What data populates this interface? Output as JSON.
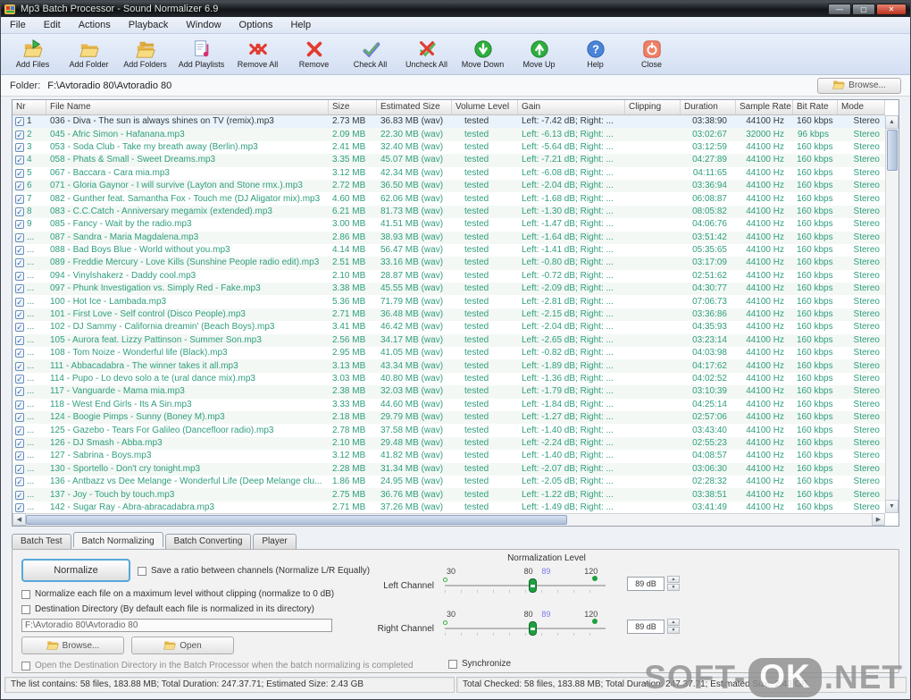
{
  "window": {
    "title": "Mp3 Batch Processor - Sound Normalizer 6.9"
  },
  "menu": {
    "items": [
      {
        "label": "File"
      },
      {
        "label": "Edit"
      },
      {
        "label": "Actions"
      },
      {
        "label": "Playback"
      },
      {
        "label": "Window"
      },
      {
        "label": "Options"
      },
      {
        "label": "Help"
      }
    ]
  },
  "toolbar": {
    "buttons": [
      {
        "label": "Add Files",
        "icon": "add-files-icon"
      },
      {
        "label": "Add Folder",
        "icon": "add-folder-icon"
      },
      {
        "label": "Add Folders",
        "icon": "add-folders-icon"
      },
      {
        "label": "Add Playlists",
        "icon": "add-playlists-icon"
      },
      {
        "label": "Remove All",
        "icon": "remove-all-icon"
      },
      {
        "label": "Remove",
        "icon": "remove-icon"
      },
      {
        "label": "Check All",
        "icon": "check-all-icon"
      },
      {
        "label": "Uncheck All",
        "icon": "uncheck-all-icon"
      },
      {
        "label": "Move Down",
        "icon": "move-down-icon"
      },
      {
        "label": "Move Up",
        "icon": "move-up-icon"
      },
      {
        "label": "Help",
        "icon": "help-icon"
      },
      {
        "label": "Close",
        "icon": "close-icon"
      }
    ]
  },
  "folder_bar": {
    "label": "Folder:",
    "path": "F:\\Avtoradio 80\\Avtoradio 80",
    "browse": "Browse..."
  },
  "table": {
    "columns": [
      {
        "label": "Nr"
      },
      {
        "label": "File Name"
      },
      {
        "label": "Size"
      },
      {
        "label": "Estimated Size"
      },
      {
        "label": "Volume Level"
      },
      {
        "label": "Gain"
      },
      {
        "label": "Clipping"
      },
      {
        "label": "Duration"
      },
      {
        "label": "Sample Rate"
      },
      {
        "label": "Bit Rate"
      },
      {
        "label": "Mode"
      }
    ],
    "rows": [
      {
        "selected": true,
        "nr": "1",
        "name": "036 - Diva - The sun is always shines on TV (remix).mp3",
        "size": "2.73 MB",
        "est": "36.83 MB (wav)",
        "vol": "tested",
        "gain": "Left: -7.42 dB; Right: ...",
        "clip": "",
        "dur": "03:38:90",
        "rate": "44100 Hz",
        "bit": "160 kbps",
        "mode": "Stereo"
      },
      {
        "nr": "2",
        "name": "045 - Afric Simon - Hafanana.mp3",
        "size": "2.09 MB",
        "est": "22.30 MB (wav)",
        "vol": "tested",
        "gain": "Left: -6.13 dB; Right: ...",
        "clip": "",
        "dur": "03:02:67",
        "rate": "32000 Hz",
        "bit": "96 kbps",
        "mode": "Stereo"
      },
      {
        "nr": "3",
        "name": "053 - Soda Club - Take my breath away (Berlin).mp3",
        "size": "2.41 MB",
        "est": "32.40 MB (wav)",
        "vol": "tested",
        "gain": "Left: -5.64 dB; Right: ...",
        "clip": "",
        "dur": "03:12:59",
        "rate": "44100 Hz",
        "bit": "160 kbps",
        "mode": "Stereo"
      },
      {
        "nr": "4",
        "name": "058 - Phats & Small - Sweet Dreams.mp3",
        "size": "3.35 MB",
        "est": "45.07 MB (wav)",
        "vol": "tested",
        "gain": "Left: -7.21 dB; Right: ...",
        "clip": "",
        "dur": "04:27:89",
        "rate": "44100 Hz",
        "bit": "160 kbps",
        "mode": "Stereo"
      },
      {
        "nr": "5",
        "name": "067 - Baccara - Cara mia.mp3",
        "size": "3.12 MB",
        "est": "42.34 MB (wav)",
        "vol": "tested",
        "gain": "Left: -6.08 dB; Right: ...",
        "clip": "",
        "dur": "04:11:65",
        "rate": "44100 Hz",
        "bit": "160 kbps",
        "mode": "Stereo"
      },
      {
        "nr": "6",
        "name": "071 - Gloria Gaynor - I will survive (Layton and Stone rmx.).mp3",
        "size": "2.72 MB",
        "est": "36.50 MB (wav)",
        "vol": "tested",
        "gain": "Left: -2.04 dB; Right: ...",
        "clip": "",
        "dur": "03:36:94",
        "rate": "44100 Hz",
        "bit": "160 kbps",
        "mode": "Stereo"
      },
      {
        "nr": "7",
        "name": "082 - Gunther feat. Samantha Fox - Touch me (DJ Aligator mix).mp3",
        "size": "4.60 MB",
        "est": "62.06 MB (wav)",
        "vol": "tested",
        "gain": "Left: -1.68 dB; Right: ...",
        "clip": "",
        "dur": "06:08:87",
        "rate": "44100 Hz",
        "bit": "160 kbps",
        "mode": "Stereo"
      },
      {
        "nr": "8",
        "name": "083 - C.C.Catch - Anniversary megamix (extended).mp3",
        "size": "6.21 MB",
        "est": "81.73 MB (wav)",
        "vol": "tested",
        "gain": "Left: -1.30 dB; Right: ...",
        "clip": "",
        "dur": "08:05:82",
        "rate": "44100 Hz",
        "bit": "160 kbps",
        "mode": "Stereo"
      },
      {
        "nr": "9",
        "name": "085 - Fancy - Wait by the radio.mp3",
        "size": "3.00 MB",
        "est": "41.51 MB (wav)",
        "vol": "tested",
        "gain": "Left: -1.47 dB; Right: ...",
        "clip": "",
        "dur": "04:06:76",
        "rate": "44100 Hz",
        "bit": "160 kbps",
        "mode": "Stereo"
      },
      {
        "nr": "...",
        "name": "087 - Sandra - Maria Magdalena.mp3",
        "size": "2.86 MB",
        "est": "38.93 MB (wav)",
        "vol": "tested",
        "gain": "Left: -1.64 dB; Right: ...",
        "clip": "",
        "dur": "03:51:42",
        "rate": "44100 Hz",
        "bit": "160 kbps",
        "mode": "Stereo"
      },
      {
        "nr": "...",
        "name": "088 - Bad Boys Blue - World without you.mp3",
        "size": "4.14 MB",
        "est": "56.47 MB (wav)",
        "vol": "tested",
        "gain": "Left: -1.41 dB; Right: ...",
        "clip": "",
        "dur": "05:35:65",
        "rate": "44100 Hz",
        "bit": "160 kbps",
        "mode": "Stereo"
      },
      {
        "nr": "...",
        "name": "089 - Freddie Mercury - Love Kills (Sunshine People radio edit).mp3",
        "size": "2.51 MB",
        "est": "33.16 MB (wav)",
        "vol": "tested",
        "gain": "Left: -0.80 dB; Right: ...",
        "clip": "",
        "dur": "03:17:09",
        "rate": "44100 Hz",
        "bit": "160 kbps",
        "mode": "Stereo"
      },
      {
        "nr": "...",
        "name": "094 - Vinylshakerz - Daddy cool.mp3",
        "size": "2.10 MB",
        "est": "28.87 MB (wav)",
        "vol": "tested",
        "gain": "Left: -0.72 dB; Right: ...",
        "clip": "",
        "dur": "02:51:62",
        "rate": "44100 Hz",
        "bit": "160 kbps",
        "mode": "Stereo"
      },
      {
        "nr": "...",
        "name": "097 - Phunk Investigation vs. Simply Red - Fake.mp3",
        "size": "3.38 MB",
        "est": "45.55 MB (wav)",
        "vol": "tested",
        "gain": "Left: -2.09 dB; Right: ...",
        "clip": "",
        "dur": "04:30:77",
        "rate": "44100 Hz",
        "bit": "160 kbps",
        "mode": "Stereo"
      },
      {
        "nr": "...",
        "name": "100 - Hot Ice - Lambada.mp3",
        "size": "5.36 MB",
        "est": "71.79 MB (wav)",
        "vol": "tested",
        "gain": "Left: -2.81 dB; Right: ...",
        "clip": "",
        "dur": "07:06:73",
        "rate": "44100 Hz",
        "bit": "160 kbps",
        "mode": "Stereo"
      },
      {
        "nr": "...",
        "name": "101 - First Love - Self control (Disco People).mp3",
        "size": "2.71 MB",
        "est": "36.48 MB (wav)",
        "vol": "tested",
        "gain": "Left: -2.15 dB; Right: ...",
        "clip": "",
        "dur": "03:36:86",
        "rate": "44100 Hz",
        "bit": "160 kbps",
        "mode": "Stereo"
      },
      {
        "nr": "...",
        "name": "102 - DJ Sammy - California dreamin' (Beach Boys).mp3",
        "size": "3.41 MB",
        "est": "46.42 MB (wav)",
        "vol": "tested",
        "gain": "Left: -2.04 dB; Right: ...",
        "clip": "",
        "dur": "04:35:93",
        "rate": "44100 Hz",
        "bit": "160 kbps",
        "mode": "Stereo"
      },
      {
        "nr": "...",
        "name": "105 - Aurora feat. Lizzy Pattinson - Summer Son.mp3",
        "size": "2.56 MB",
        "est": "34.17 MB (wav)",
        "vol": "tested",
        "gain": "Left: -2.65 dB; Right: ...",
        "clip": "",
        "dur": "03:23:14",
        "rate": "44100 Hz",
        "bit": "160 kbps",
        "mode": "Stereo"
      },
      {
        "nr": "...",
        "name": "108 - Tom Noize - Wonderful life (Black).mp3",
        "size": "2.95 MB",
        "est": "41.05 MB (wav)",
        "vol": "tested",
        "gain": "Left: -0.82 dB; Right: ...",
        "clip": "",
        "dur": "04:03:98",
        "rate": "44100 Hz",
        "bit": "160 kbps",
        "mode": "Stereo"
      },
      {
        "nr": "...",
        "name": "111 - Abbacadabra - The winner takes it all.mp3",
        "size": "3.13 MB",
        "est": "43.34 MB (wav)",
        "vol": "tested",
        "gain": "Left: -1.89 dB; Right: ...",
        "clip": "",
        "dur": "04:17:62",
        "rate": "44100 Hz",
        "bit": "160 kbps",
        "mode": "Stereo"
      },
      {
        "nr": "...",
        "name": "114 - Pupo - Lo devo solo a te (ural dance mix).mp3",
        "size": "3.03 MB",
        "est": "40.80 MB (wav)",
        "vol": "tested",
        "gain": "Left: -1.36 dB; Right: ...",
        "clip": "",
        "dur": "04:02:52",
        "rate": "44100 Hz",
        "bit": "160 kbps",
        "mode": "Stereo"
      },
      {
        "nr": "...",
        "name": "117 - Vanguarde - Mama mia.mp3",
        "size": "2.38 MB",
        "est": "32.03 MB (wav)",
        "vol": "tested",
        "gain": "Left: -1.79 dB; Right: ...",
        "clip": "",
        "dur": "03:10:39",
        "rate": "44100 Hz",
        "bit": "160 kbps",
        "mode": "Stereo"
      },
      {
        "nr": "...",
        "name": "118 - West End Girls - Its A Sin.mp3",
        "size": "3.33 MB",
        "est": "44.60 MB (wav)",
        "vol": "tested",
        "gain": "Left: -1.84 dB; Right: ...",
        "clip": "",
        "dur": "04:25:14",
        "rate": "44100 Hz",
        "bit": "160 kbps",
        "mode": "Stereo"
      },
      {
        "nr": "...",
        "name": "124 - Boogie Pimps - Sunny (Boney M).mp3",
        "size": "2.18 MB",
        "est": "29.79 MB (wav)",
        "vol": "tested",
        "gain": "Left: -1.27 dB; Right: ...",
        "clip": "",
        "dur": "02:57:06",
        "rate": "44100 Hz",
        "bit": "160 kbps",
        "mode": "Stereo"
      },
      {
        "nr": "...",
        "name": "125 - Gazebo - Tears For Galileo (Dancefloor radio).mp3",
        "size": "2.78 MB",
        "est": "37.58 MB (wav)",
        "vol": "tested",
        "gain": "Left: -1.40 dB; Right: ...",
        "clip": "",
        "dur": "03:43:40",
        "rate": "44100 Hz",
        "bit": "160 kbps",
        "mode": "Stereo"
      },
      {
        "nr": "...",
        "name": "126 - DJ Smash - Abba.mp3",
        "size": "2.10 MB",
        "est": "29.48 MB (wav)",
        "vol": "tested",
        "gain": "Left: -2.24 dB; Right: ...",
        "clip": "",
        "dur": "02:55:23",
        "rate": "44100 Hz",
        "bit": "160 kbps",
        "mode": "Stereo"
      },
      {
        "nr": "...",
        "name": "127 - Sabrina - Boys.mp3",
        "size": "3.12 MB",
        "est": "41.82 MB (wav)",
        "vol": "tested",
        "gain": "Left: -1.40 dB; Right: ...",
        "clip": "",
        "dur": "04:08:57",
        "rate": "44100 Hz",
        "bit": "160 kbps",
        "mode": "Stereo"
      },
      {
        "nr": "...",
        "name": "130 - Sportello - Don't cry tonight.mp3",
        "size": "2.28 MB",
        "est": "31.34 MB (wav)",
        "vol": "tested",
        "gain": "Left: -2.07 dB; Right: ...",
        "clip": "",
        "dur": "03:06:30",
        "rate": "44100 Hz",
        "bit": "160 kbps",
        "mode": "Stereo"
      },
      {
        "nr": "...",
        "name": "136 - Antbazz vs Dee Melange - Wonderful Life (Deep Melange clu...",
        "size": "1.86 MB",
        "est": "24.95 MB (wav)",
        "vol": "tested",
        "gain": "Left: -2.05 dB; Right: ...",
        "clip": "",
        "dur": "02:28:32",
        "rate": "44100 Hz",
        "bit": "160 kbps",
        "mode": "Stereo"
      },
      {
        "nr": "...",
        "name": "137 - Joy - Touch by touch.mp3",
        "size": "2.75 MB",
        "est": "36.76 MB (wav)",
        "vol": "tested",
        "gain": "Left: -1.22 dB; Right: ...",
        "clip": "",
        "dur": "03:38:51",
        "rate": "44100 Hz",
        "bit": "160 kbps",
        "mode": "Stereo"
      },
      {
        "nr": "...",
        "name": "142 - Sugar Ray - Abra-abracadabra.mp3",
        "size": "2.71 MB",
        "est": "37.26 MB (wav)",
        "vol": "tested",
        "gain": "Left: -1.49 dB; Right: ...",
        "clip": "",
        "dur": "03:41:49",
        "rate": "44100 Hz",
        "bit": "160 kbps",
        "mode": "Stereo"
      }
    ]
  },
  "tabs": {
    "items": [
      {
        "label": "Batch Test"
      },
      {
        "label": "Batch Normalizing",
        "active": true
      },
      {
        "label": "Batch Converting"
      },
      {
        "label": "Player"
      }
    ]
  },
  "panel": {
    "normalize_button": "Normalize",
    "save_ratio_label": "Save a ratio between channels (Normalize L/R Equally)",
    "max_level_label": "Normalize each file on a maximum level without clipping (normalize to 0 dB)",
    "dest_dir_label": "Destination Directory (By default each file is normalized in its directory)",
    "destination_value": "F:\\Avtoradio 80\\Avtoradio 80",
    "browse_label": "Browse...",
    "open_label": "Open",
    "open_dest_label": "Open the Destination Directory in the Batch Processor when the batch normalizing is completed",
    "synchronize_label": "Synchronize",
    "normalization": {
      "title": "Normalization Level",
      "channels": [
        {
          "label": "Left Channel",
          "tick_low": "30",
          "tick_mid": "80",
          "tick_value": "89",
          "tick_high": "120",
          "value": "89 dB"
        },
        {
          "label": "Right Channel",
          "tick_low": "30",
          "tick_mid": "80",
          "tick_value": "89",
          "tick_high": "120",
          "value": "89 dB"
        }
      ]
    }
  },
  "status_bar": {
    "left": "The list contains: 58 files, 183.88 MB; Total Duration: 247.37.71; Estimated Size: 2.43 GB",
    "right": "Total Checked: 58 files, 183.88 MB; Total Duration: 247.37.71; Estimated Size: 2.43 GB"
  },
  "watermark": {
    "part1": "SOFT-",
    "part2": "OK",
    "part3": ".NET"
  },
  "colors": {
    "accent_green_text": "#2f9e7e",
    "slider_green": "#1fa040",
    "tick_blue": "#7a7af0",
    "close_red": "#b93320"
  }
}
